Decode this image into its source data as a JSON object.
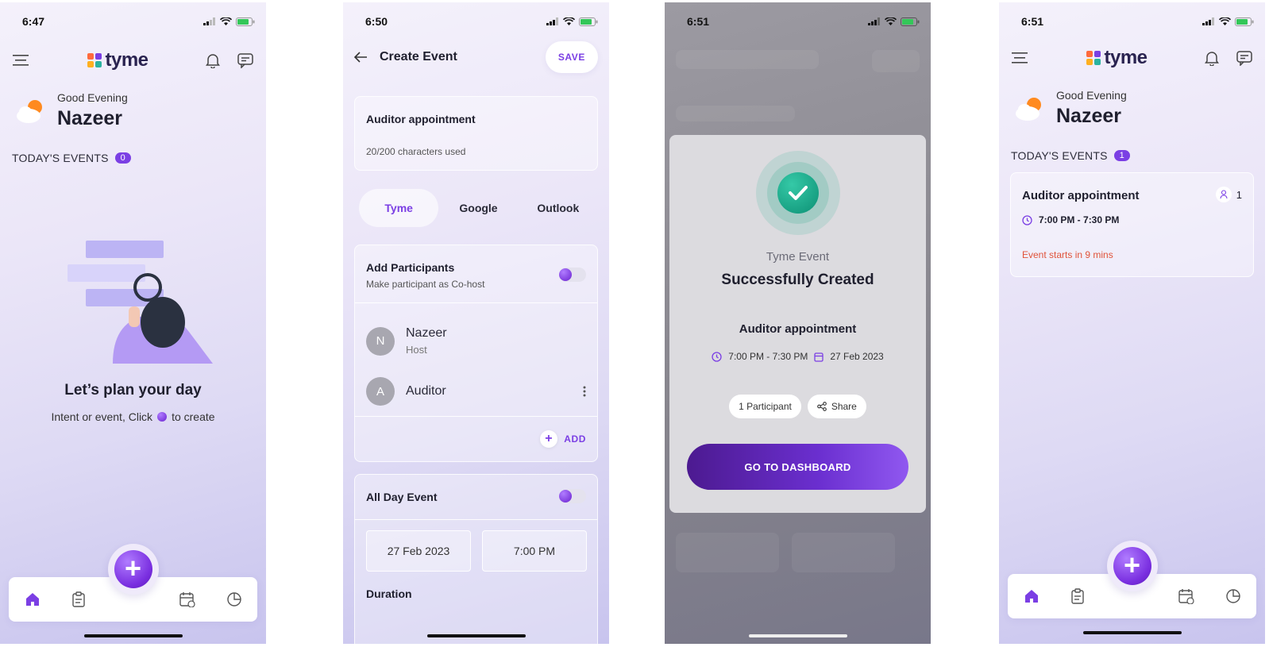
{
  "colors": {
    "accent": "#7b3fe4",
    "success": "#16a085",
    "warning": "#e0533a"
  },
  "screen1": {
    "time": "6:47",
    "brand": "tyme",
    "greeting": "Good Evening",
    "user": "Nazeer",
    "events_label": "TODAY'S EVENTS",
    "events_count": "0",
    "empty_title": "Let’s plan your day",
    "empty_sub_before": "Intent or event, Click",
    "empty_sub_after": "to create"
  },
  "screen2": {
    "time": "6:50",
    "title": "Create Event",
    "save": "SAVE",
    "event_name": "Auditor appointment",
    "char_count": "20/200 characters used",
    "tabs": [
      "Tyme",
      "Google",
      "Outlook"
    ],
    "participants_title": "Add Participants",
    "participants_sub": "Make participant as Co-host",
    "participants": [
      {
        "initial": "N",
        "name": "Nazeer",
        "role": "Host"
      },
      {
        "initial": "A",
        "name": "Auditor",
        "role": ""
      }
    ],
    "add": "ADD",
    "all_day": "All Day Event",
    "date": "27 Feb 2023",
    "start_time": "7:00 PM",
    "duration": "Duration"
  },
  "screen3": {
    "time": "6:51",
    "subtitle": "Tyme Event",
    "title": "Successfully Created",
    "event_name": "Auditor appointment",
    "time_range": "7:00 PM - 7:30 PM",
    "date": "27 Feb 2023",
    "participants_chip": "1 Participant",
    "share_chip": "Share",
    "dashboard_btn": "GO TO DASHBOARD"
  },
  "screen4": {
    "time": "6:51",
    "brand": "tyme",
    "greeting": "Good Evening",
    "user": "Nazeer",
    "events_label": "TODAY'S EVENTS",
    "events_count": "1",
    "event": {
      "title": "Auditor appointment",
      "time_range": "7:00 PM - 7:30 PM",
      "warning": "Event starts in 9 mins",
      "participants": "1"
    }
  }
}
